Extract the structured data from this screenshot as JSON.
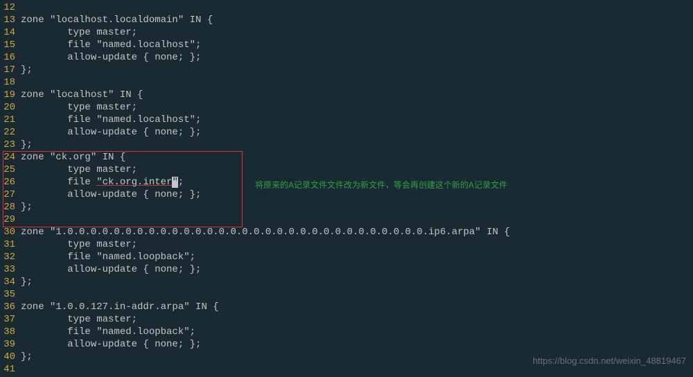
{
  "lines": [
    {
      "num": "12",
      "content": ""
    },
    {
      "num": "13",
      "content": "zone \"localhost.localdomain\" IN {"
    },
    {
      "num": "14",
      "content": "        type master;"
    },
    {
      "num": "15",
      "content": "        file \"named.localhost\";"
    },
    {
      "num": "16",
      "content": "        allow-update { none; };"
    },
    {
      "num": "17",
      "content": "};"
    },
    {
      "num": "18",
      "content": ""
    },
    {
      "num": "19",
      "content": "zone \"localhost\" IN {"
    },
    {
      "num": "20",
      "content": "        type master;"
    },
    {
      "num": "21",
      "content": "        file \"named.localhost\";"
    },
    {
      "num": "22",
      "content": "        allow-update { none; };"
    },
    {
      "num": "23",
      "content": "};"
    },
    {
      "num": "24",
      "content": "zone \"ck.org\" IN {"
    },
    {
      "num": "25",
      "content": "        type master;"
    },
    {
      "num": "26",
      "content": "        file \"ck.org.inter\";",
      "special": true
    },
    {
      "num": "27",
      "content": "        allow-update { none; };"
    },
    {
      "num": "28",
      "content": "};"
    },
    {
      "num": "29",
      "content": ""
    },
    {
      "num": "30",
      "content": "zone \"1.0.0.0.0.0.0.0.0.0.0.0.0.0.0.0.0.0.0.0.0.0.0.0.0.0.0.0.0.0.0.0.ip6.arpa\" IN {"
    },
    {
      "num": "31",
      "content": "        type master;"
    },
    {
      "num": "32",
      "content": "        file \"named.loopback\";"
    },
    {
      "num": "33",
      "content": "        allow-update { none; };"
    },
    {
      "num": "34",
      "content": "};"
    },
    {
      "num": "35",
      "content": ""
    },
    {
      "num": "36",
      "content": "zone \"1.0.0.127.in-addr.arpa\" IN {"
    },
    {
      "num": "37",
      "content": "        type master;"
    },
    {
      "num": "38",
      "content": "        file \"named.loopback\";"
    },
    {
      "num": "39",
      "content": "        allow-update { none; };"
    },
    {
      "num": "40",
      "content": "};"
    },
    {
      "num": "41",
      "content": ""
    }
  ],
  "special_line": {
    "prefix": "        file ",
    "underlined": "\"ck.org.inter",
    "cursor_char": "\"",
    "suffix": ";"
  },
  "annotation": "将原来的A记录文件文件改为新文件，等会再创建这个新的A记录文件",
  "watermark": "https://blog.csdn.net/weixin_48819467"
}
